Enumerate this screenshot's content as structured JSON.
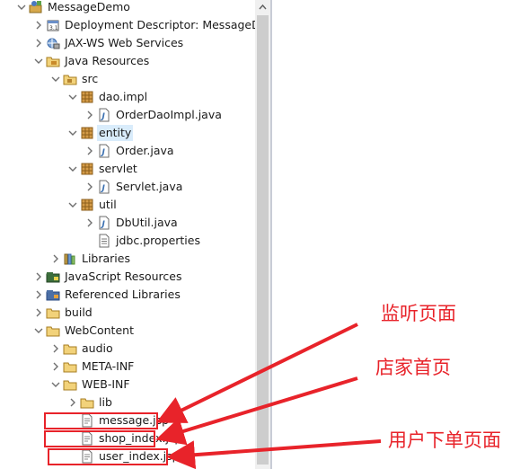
{
  "tree": [
    {
      "label": "MessageDemo",
      "icon": "project-icon",
      "expanded": true
    },
    {
      "label": "Deployment Descriptor: MessageDemo",
      "icon": "deployment-descriptor-icon",
      "expanded": false
    },
    {
      "label": "JAX-WS Web Services",
      "icon": "web-services-icon",
      "expanded": false
    },
    {
      "label": "Java Resources",
      "icon": "java-resources-icon",
      "expanded": true
    },
    {
      "label": "src",
      "icon": "source-folder-icon",
      "expanded": true
    },
    {
      "label": "dao.impl",
      "icon": "package-icon",
      "expanded": true
    },
    {
      "label": "OrderDaoImpl.java",
      "icon": "java-file-icon",
      "expanded": false
    },
    {
      "label": "entity",
      "icon": "package-icon",
      "expanded": true,
      "selected": true
    },
    {
      "label": "Order.java",
      "icon": "java-file-icon",
      "expanded": false
    },
    {
      "label": "servlet",
      "icon": "package-icon",
      "expanded": true
    },
    {
      "label": "Servlet.java",
      "icon": "java-file-icon",
      "expanded": false
    },
    {
      "label": "util",
      "icon": "package-icon",
      "expanded": true
    },
    {
      "label": "DbUtil.java",
      "icon": "java-file-icon",
      "expanded": false
    },
    {
      "label": "jdbc.properties",
      "icon": "properties-file-icon"
    },
    {
      "label": "Libraries",
      "icon": "libraries-icon",
      "expanded": false
    },
    {
      "label": "JavaScript Resources",
      "icon": "javascript-resources-icon",
      "expanded": false
    },
    {
      "label": "Referenced Libraries",
      "icon": "referenced-libraries-icon",
      "expanded": false
    },
    {
      "label": "build",
      "icon": "folder-icon",
      "expanded": false
    },
    {
      "label": "WebContent",
      "icon": "folder-icon",
      "expanded": true
    },
    {
      "label": "audio",
      "icon": "folder-icon",
      "expanded": false
    },
    {
      "label": "META-INF",
      "icon": "folder-icon",
      "expanded": false
    },
    {
      "label": "WEB-INF",
      "icon": "folder-icon",
      "expanded": true
    },
    {
      "label": "lib",
      "icon": "folder-icon",
      "expanded": false
    },
    {
      "label": "message.jsp",
      "icon": "jsp-file-icon"
    },
    {
      "label": "shop_index.jsp",
      "icon": "jsp-file-icon"
    },
    {
      "label": "user_index.jsp",
      "icon": "jsp-file-icon"
    }
  ],
  "annotations": [
    {
      "text": "监听页面",
      "target": "message.jsp"
    },
    {
      "text": "店家首页",
      "target": "shop_index.jsp"
    },
    {
      "text": "用户下单页面",
      "target": "user_index.jsp"
    }
  ],
  "colors": {
    "highlight": "#e8232a",
    "selection": "#d9ecfb",
    "folder": "#e8c25a",
    "package": "#b5832f",
    "java_file": "#3a6fb0"
  }
}
